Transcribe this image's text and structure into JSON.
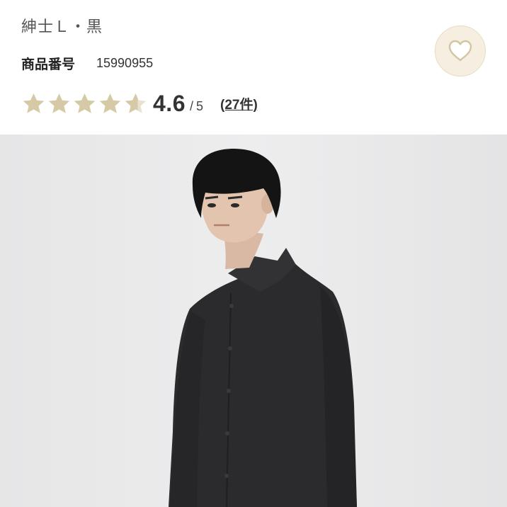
{
  "product": {
    "subtitle": "紳士Ｌ・黒",
    "code_label": "商品番号",
    "code_value": "15990955"
  },
  "rating": {
    "value": "4.6",
    "separator": "/",
    "max": "5",
    "score": 4.6,
    "review_count_label": "(27件)"
  },
  "favorite": {
    "icon": "heart-icon"
  },
  "colors": {
    "star_fill": "#d6c9a6",
    "star_empty": "#e9e2cf",
    "heart_bg": "#f6efe1",
    "shirt": "#2b2b2d",
    "image_bg": "#e9e9ea"
  }
}
